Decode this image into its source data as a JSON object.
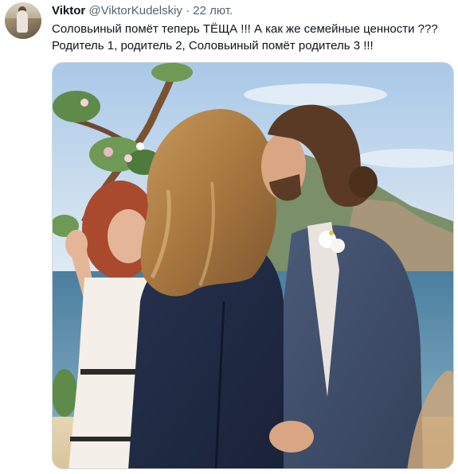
{
  "tweet": {
    "author": {
      "display_name": "Viktor",
      "handle": "@ViktorKudelskiy",
      "avatar_icon": "user-avatar"
    },
    "separator": "·",
    "timestamp": "22 лют.",
    "text_lines": [
      "Соловьиный помёт теперь ТЁЩА !!! А как же семейные ценности ???",
      "Родитель 1, родитель 2, Соловьиный помёт родитель 3 !!!"
    ],
    "media": {
      "kind": "photo"
    }
  },
  "colors": {
    "text_primary": "#0f1419",
    "text_secondary": "#536471",
    "border": "#cfd9de"
  }
}
